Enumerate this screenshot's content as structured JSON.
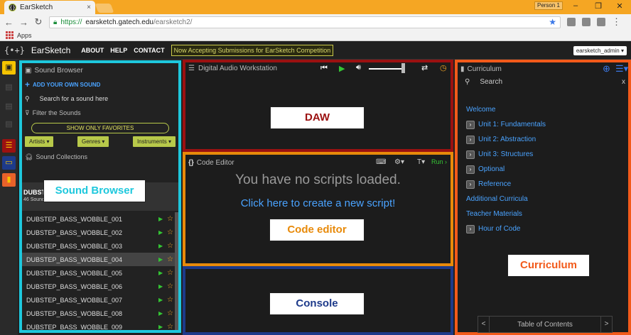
{
  "browser": {
    "tab_title": "EarSketch",
    "tab_close": "×",
    "person": "Person 1",
    "url_https": "https://",
    "url_host": "earsketch.gatech.edu",
    "url_path": "/earsketch2/",
    "bookmarks_apps": "Apps"
  },
  "header": {
    "logo": "{•+}",
    "brand": "EarSketch",
    "nav": [
      "ABOUT",
      "HELP",
      "CONTACT"
    ],
    "banner": "Now Accepting Submissions for EarSketch Competition",
    "user": "earsketch_admin ▾"
  },
  "sound_browser": {
    "title": "Sound Browser",
    "add_sound": "ADD YOUR OWN SOUND",
    "search_placeholder": "Search for a sound here",
    "filter_title": "Filter the Sounds",
    "show_favorites": "SHOW ONLY FAVORITES",
    "filters": [
      "Artists ▾",
      "Genres ▾",
      "Instruments ▾"
    ],
    "collections_title": "Sound Collections",
    "collection_name": "DUBSTEP",
    "collection_count": "46 Sounds",
    "sounds": [
      "DUBSTEP_BASS_WOBBLE_001",
      "DUBSTEP_BASS_WOBBLE_002",
      "DUBSTEP_BASS_WOBBLE_003",
      "DUBSTEP_BASS_WOBBLE_004",
      "DUBSTEP_BASS_WOBBLE_005",
      "DUBSTEP_BASS_WOBBLE_006",
      "DUBSTEP_BASS_WOBBLE_007",
      "DUBSTEP_BASS_WOBBLE_008",
      "DUBSTEP_BASS_WOBBLE_009"
    ],
    "selected_index": 3,
    "overlay_label": "Sound Browser"
  },
  "daw": {
    "title": "Digital Audio Workstation",
    "overlay_label": "DAW"
  },
  "code_editor": {
    "title": "Code Editor",
    "run": "Run",
    "empty_msg": "You have no scripts loaded.",
    "create_link": "Click here to create a new script!",
    "overlay_label": "Code editor"
  },
  "console": {
    "overlay_label": "Console"
  },
  "curriculum": {
    "title": "Curriculum",
    "search_placeholder": "Search",
    "search_close": "x",
    "items": [
      {
        "label": "Welcome",
        "chev": false
      },
      {
        "label": "Unit 1: Fundamentals",
        "chev": true
      },
      {
        "label": "Unit 2: Abstraction",
        "chev": true
      },
      {
        "label": "Unit 3: Structures",
        "chev": true
      },
      {
        "label": "Optional",
        "chev": true
      },
      {
        "label": "Reference",
        "chev": true
      },
      {
        "label": "Additional Curricula",
        "chev": false
      },
      {
        "label": "Teacher Materials",
        "chev": false
      },
      {
        "label": "Hour of Code",
        "chev": true
      }
    ],
    "toc": "Table of Contents",
    "prev": "<",
    "next": ">",
    "overlay_label": "Curriculum"
  },
  "colors": {
    "sound_browser_border": "#1ec8dd",
    "daw_border": "#9b1111",
    "code_border": "#e88a0a",
    "console_border": "#1d3a8a",
    "curriculum_border": "#f25a1a"
  }
}
